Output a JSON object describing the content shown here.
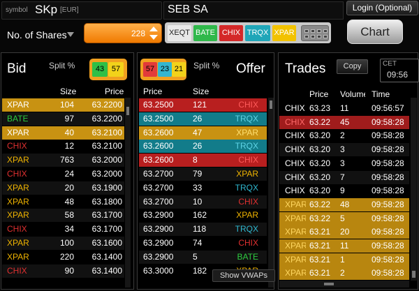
{
  "header": {
    "symbol_label": "symbol",
    "symbol": "SKp",
    "currency": "[EUR]",
    "company": "SEB SA",
    "login": "Login (Optional)",
    "chart": "Chart"
  },
  "order": {
    "shares_label": "No. of Shares",
    "quantity": "228"
  },
  "venues": [
    {
      "label": "XEQT",
      "bg": "#e8e8e8",
      "color": "#222222"
    },
    {
      "label": "BATE",
      "bg": "#2fb84a",
      "color": "#ffffff"
    },
    {
      "label": "CHIX",
      "bg": "#d42828",
      "color": "#ffffff"
    },
    {
      "label": "TRQX",
      "bg": "#1fa6b8",
      "color": "#ffffff"
    },
    {
      "label": "XPAR",
      "bg": "#f2c200",
      "color": "#ffffff"
    }
  ],
  "bid": {
    "title": "Bid",
    "split_label": "Split %",
    "split": [
      {
        "value": "43",
        "bg": "#2fbf47"
      },
      {
        "value": "57",
        "bg": "#f2d21a"
      }
    ],
    "col_size": "Size",
    "col_price": "Price",
    "rows": [
      {
        "venue": "XPAR",
        "size": "104",
        "price": "63.2200",
        "venue_color": "#ffffff",
        "bg": "#c89212"
      },
      {
        "venue": "BATE",
        "size": "97",
        "price": "63.2200",
        "venue_color": "#2ecc40",
        "bg": "#121212"
      },
      {
        "venue": "XPAR",
        "size": "40",
        "price": "63.2100",
        "venue_color": "#ffffff",
        "bg": "#c89212"
      },
      {
        "venue": "CHIX",
        "size": "12",
        "price": "63.2100",
        "venue_color": "#e03030",
        "bg": "#000000"
      },
      {
        "venue": "XPAR",
        "size": "763",
        "price": "63.2000",
        "venue_color": "#f0b400",
        "bg": "#111111"
      },
      {
        "venue": "CHIX",
        "size": "24",
        "price": "63.2000",
        "venue_color": "#e03030",
        "bg": "#000000"
      },
      {
        "venue": "XPAR",
        "size": "20",
        "price": "63.1900",
        "venue_color": "#f0b400",
        "bg": "#111111"
      },
      {
        "venue": "XPAR",
        "size": "48",
        "price": "63.1800",
        "venue_color": "#f0b400",
        "bg": "#000000"
      },
      {
        "venue": "XPAR",
        "size": "58",
        "price": "63.1700",
        "venue_color": "#f0b400",
        "bg": "#111111"
      },
      {
        "venue": "CHIX",
        "size": "34",
        "price": "63.1700",
        "venue_color": "#e03030",
        "bg": "#000000"
      },
      {
        "venue": "XPAR",
        "size": "100",
        "price": "63.1600",
        "venue_color": "#f0b400",
        "bg": "#111111"
      },
      {
        "venue": "XPAR",
        "size": "220",
        "price": "63.1400",
        "venue_color": "#f0b400",
        "bg": "#000000"
      },
      {
        "venue": "CHIX",
        "size": "90",
        "price": "63.1400",
        "venue_color": "#e03030",
        "bg": "#111111"
      }
    ]
  },
  "offer": {
    "title": "Offer",
    "split_label": "Split %",
    "split": [
      {
        "value": "57",
        "bg": "#e23a3a"
      },
      {
        "value": "23",
        "bg": "#33b5cf"
      },
      {
        "value": "21",
        "bg": "#f2d21a"
      }
    ],
    "col_price": "Price",
    "col_size": "Size",
    "show_vwaps": "Show VWAPs",
    "rows": [
      {
        "price": "63.2500",
        "size": "121",
        "venue": "CHIX",
        "venue_color": "#ff5a5a",
        "bg": "#b81f1f"
      },
      {
        "price": "63.2500",
        "size": "26",
        "venue": "TRQX",
        "venue_color": "#5fd4e6",
        "bg": "#127c8a"
      },
      {
        "price": "63.2600",
        "size": "47",
        "venue": "XPAR",
        "venue_color": "#ffe070",
        "bg": "#c89212"
      },
      {
        "price": "63.2600",
        "size": "26",
        "venue": "TRQX",
        "venue_color": "#5fd4e6",
        "bg": "#127c8a"
      },
      {
        "price": "63.2600",
        "size": "8",
        "venue": "CHIX",
        "venue_color": "#ff5a5a",
        "bg": "#b81f1f"
      },
      {
        "price": "63.2700",
        "size": "79",
        "venue": "XPAR",
        "venue_color": "#f0b400",
        "bg": "#111111"
      },
      {
        "price": "63.2700",
        "size": "33",
        "venue": "TRQX",
        "venue_color": "#2fb8d0",
        "bg": "#000000"
      },
      {
        "price": "63.2700",
        "size": "10",
        "venue": "CHIX",
        "venue_color": "#e03030",
        "bg": "#111111"
      },
      {
        "price": "63.2900",
        "size": "162",
        "venue": "XPAR",
        "venue_color": "#f0b400",
        "bg": "#000000"
      },
      {
        "price": "63.2900",
        "size": "118",
        "venue": "TRQX",
        "venue_color": "#2fb8d0",
        "bg": "#111111"
      },
      {
        "price": "63.2900",
        "size": "74",
        "venue": "CHIX",
        "venue_color": "#e03030",
        "bg": "#000000"
      },
      {
        "price": "63.2900",
        "size": "5",
        "venue": "BATE",
        "venue_color": "#2ecc40",
        "bg": "#111111"
      },
      {
        "price": "63.3000",
        "size": "182",
        "venue": "XPAR",
        "venue_color": "#f0b400",
        "bg": "#000000"
      }
    ]
  },
  "trades": {
    "title": "Trades",
    "copy": "Copy",
    "cet_label": "CET",
    "cet_time": "09:56",
    "col_price": "Price",
    "col_volume": "Volume",
    "col_time": "Time",
    "rows": [
      {
        "venue": "CHIX",
        "price": "63.23",
        "volume": "11",
        "time": "09:56:57",
        "venue_color": "#ffffff",
        "bg": "#000000"
      },
      {
        "venue": "CHIX",
        "price": "63.22",
        "volume": "45",
        "time": "09:58:28",
        "venue_color": "#ff6a6a",
        "bg": "#a01c1c"
      },
      {
        "venue": "CHIX",
        "price": "63.20",
        "volume": "2",
        "time": "09:58:28",
        "venue_color": "#ffffff",
        "bg": "#000000"
      },
      {
        "venue": "CHIX",
        "price": "63.20",
        "volume": "3",
        "time": "09:58:28",
        "venue_color": "#ffffff",
        "bg": "#111111"
      },
      {
        "venue": "CHIX",
        "price": "63.20",
        "volume": "3",
        "time": "09:58:28",
        "venue_color": "#ffffff",
        "bg": "#000000"
      },
      {
        "venue": "CHIX",
        "price": "63.20",
        "volume": "7",
        "time": "09:58:28",
        "venue_color": "#ffffff",
        "bg": "#111111"
      },
      {
        "venue": "CHIX",
        "price": "63.20",
        "volume": "9",
        "time": "09:58:28",
        "venue_color": "#ffffff",
        "bg": "#000000"
      },
      {
        "venue": "XPAR",
        "price": "63.22",
        "volume": "48",
        "time": "09:58:28",
        "venue_color": "#ffd760",
        "bg": "#b8860f"
      },
      {
        "venue": "XPAR",
        "price": "63.22",
        "volume": "5",
        "time": "09:58:28",
        "venue_color": "#ffd760",
        "bg": "#b8860f"
      },
      {
        "venue": "XPAR",
        "price": "63.21",
        "volume": "20",
        "time": "09:58:28",
        "venue_color": "#ffd760",
        "bg": "#b8860f"
      },
      {
        "venue": "XPAR",
        "price": "63.21",
        "volume": "11",
        "time": "09:58:28",
        "venue_color": "#ffd760",
        "bg": "#b8860f"
      },
      {
        "venue": "XPAR",
        "price": "63.21",
        "volume": "1",
        "time": "09:58:28",
        "venue_color": "#ffd760",
        "bg": "#b8860f"
      },
      {
        "venue": "XPAR",
        "price": "63.21",
        "volume": "2",
        "time": "09:58:28",
        "venue_color": "#ffd760",
        "bg": "#b8860f"
      }
    ]
  }
}
